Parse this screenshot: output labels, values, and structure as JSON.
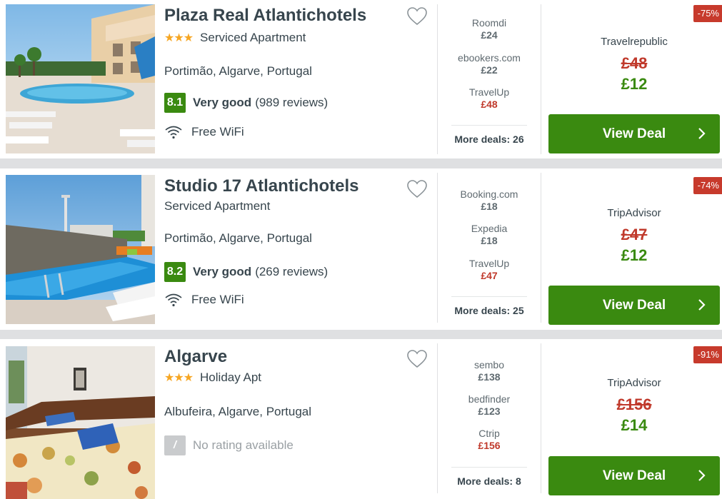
{
  "hotels": [
    {
      "name": "Plaza Real Atlantichotels",
      "stars": "★★★",
      "type": "Serviced Apartment",
      "location": "Portimão, Algarve, Portugal",
      "rating_score": "8.1",
      "rating_label": "Very good",
      "reviews": "(989 reviews)",
      "amenity": "Free WiFi",
      "deals": [
        {
          "provider": "Roomdi",
          "price": "£24"
        },
        {
          "provider": "ebookers.com",
          "price": "£22"
        },
        {
          "provider": "TravelUp",
          "price": "£48"
        }
      ],
      "more_deals": "More deals: 26",
      "discount": "-75%",
      "best_provider": "Travelrepublic",
      "old_price": "£48",
      "new_price": "£12",
      "button": "View Deal"
    },
    {
      "name": "Studio 17 Atlantichotels",
      "stars": "",
      "type": "Serviced Apartment",
      "location": "Portimão, Algarve, Portugal",
      "rating_score": "8.2",
      "rating_label": "Very good",
      "reviews": "(269 reviews)",
      "amenity": "Free WiFi",
      "deals": [
        {
          "provider": "Booking.com",
          "price": "£18"
        },
        {
          "provider": "Expedia",
          "price": "£18"
        },
        {
          "provider": "TravelUp",
          "price": "£47"
        }
      ],
      "more_deals": "More deals: 25",
      "discount": "-74%",
      "best_provider": "TripAdvisor",
      "old_price": "£47",
      "new_price": "£12",
      "button": "View Deal"
    },
    {
      "name": "Algarve",
      "stars": "★★★",
      "type": "Holiday Apt",
      "location": "Albufeira, Algarve, Portugal",
      "rating_score": "/",
      "no_rating": "No rating available",
      "deals": [
        {
          "provider": "sembo",
          "price": "£138"
        },
        {
          "provider": "bedfinder",
          "price": "£123"
        },
        {
          "provider": "Ctrip",
          "price": "£156"
        }
      ],
      "more_deals": "More deals: 8",
      "discount": "-91%",
      "best_provider": "TripAdvisor",
      "old_price": "£156",
      "new_price": "£14",
      "button": "View Deal"
    }
  ],
  "colors": {
    "primary_green": "#3a8a10",
    "strike_red": "#c0392b",
    "discount_red": "#c73a2c",
    "star_orange": "#f6a623"
  },
  "icons": [
    "favorite-heart-icon",
    "wifi-icon",
    "chevron-right-icon",
    "star-icon"
  ]
}
